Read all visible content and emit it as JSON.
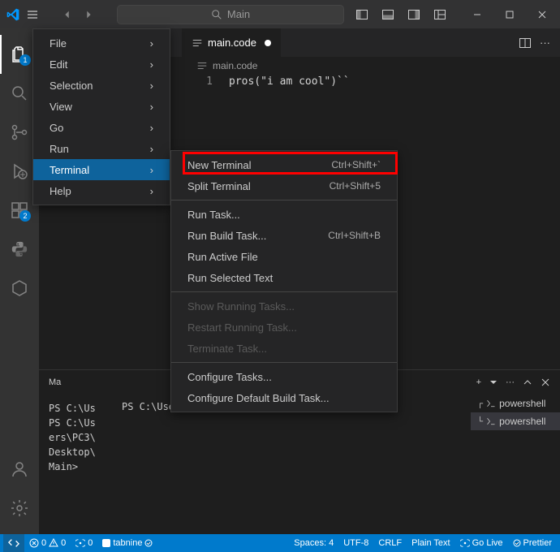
{
  "titlebar": {
    "command_center": "Main"
  },
  "menu": {
    "items": [
      {
        "label": "File"
      },
      {
        "label": "Edit"
      },
      {
        "label": "Selection"
      },
      {
        "label": "View"
      },
      {
        "label": "Go"
      },
      {
        "label": "Run"
      },
      {
        "label": "Terminal"
      },
      {
        "label": "Help"
      }
    ]
  },
  "submenu": {
    "new_terminal": {
      "label": "New Terminal",
      "shortcut": "Ctrl+Shift+`"
    },
    "split_terminal": {
      "label": "Split Terminal",
      "shortcut": "Ctrl+Shift+5"
    },
    "run_task": {
      "label": "Run Task..."
    },
    "run_build_task": {
      "label": "Run Build Task...",
      "shortcut": "Ctrl+Shift+B"
    },
    "run_active_file": {
      "label": "Run Active File"
    },
    "run_selected_text": {
      "label": "Run Selected Text"
    },
    "show_running_tasks": {
      "label": "Show Running Tasks..."
    },
    "restart_running_task": {
      "label": "Restart Running Task..."
    },
    "terminate_task": {
      "label": "Terminate Task..."
    },
    "configure_tasks": {
      "label": "Configure Tasks..."
    },
    "configure_default_build": {
      "label": "Configure Default Build Task..."
    }
  },
  "editor": {
    "tab_label": "main.code",
    "breadcrumb": "main.code",
    "line_number": "1",
    "code": "pros(\"i am cool\")``"
  },
  "activity_badges": {
    "explorer": "1",
    "extensions": "2"
  },
  "panel": {
    "truncated_tab": "Ma"
  },
  "terminal": {
    "left_wrapped": "PS C:\\Us\nPS C:\\Us\ners\\PC3\\\nDesktop\\\nMain>",
    "prompt": "PS C:\\Users\\PC3\\Desktop\\Main>",
    "tabs": [
      {
        "label": "powershell"
      },
      {
        "label": "powershell"
      }
    ]
  },
  "statusbar": {
    "errors": "0",
    "warnings": "0",
    "ports": "0",
    "tabnine": "tabnine",
    "spaces": "Spaces: 4",
    "encoding": "UTF-8",
    "eol": "CRLF",
    "language": "Plain Text",
    "golive": "Go Live",
    "prettier": "Prettier"
  }
}
